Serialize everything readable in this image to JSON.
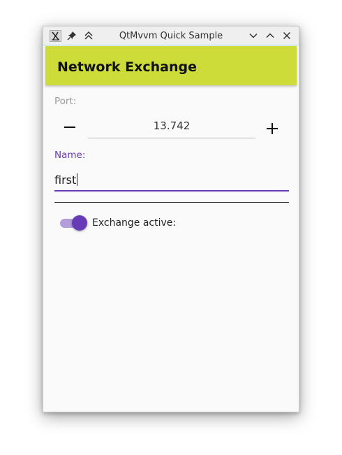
{
  "window": {
    "title": "QtMvvm Quick Sample"
  },
  "header": {
    "title": "Network Exchange",
    "color": "#cddc39"
  },
  "port": {
    "label": "Port:",
    "value": "13.742"
  },
  "name": {
    "label": "Name:",
    "value": "first"
  },
  "exchange": {
    "label": "Exchange active:",
    "checked": true
  },
  "colors": {
    "accent": "#673ab7",
    "accent_light": "#b39ddb"
  },
  "icons": {
    "app": "x-app-icon",
    "pin": "pin-icon",
    "keep_above": "keep-above-icon",
    "minimize": "chevron-down-icon",
    "maximize": "chevron-up-icon",
    "close": "close-icon",
    "decrement": "minus-icon",
    "increment": "plus-icon"
  }
}
